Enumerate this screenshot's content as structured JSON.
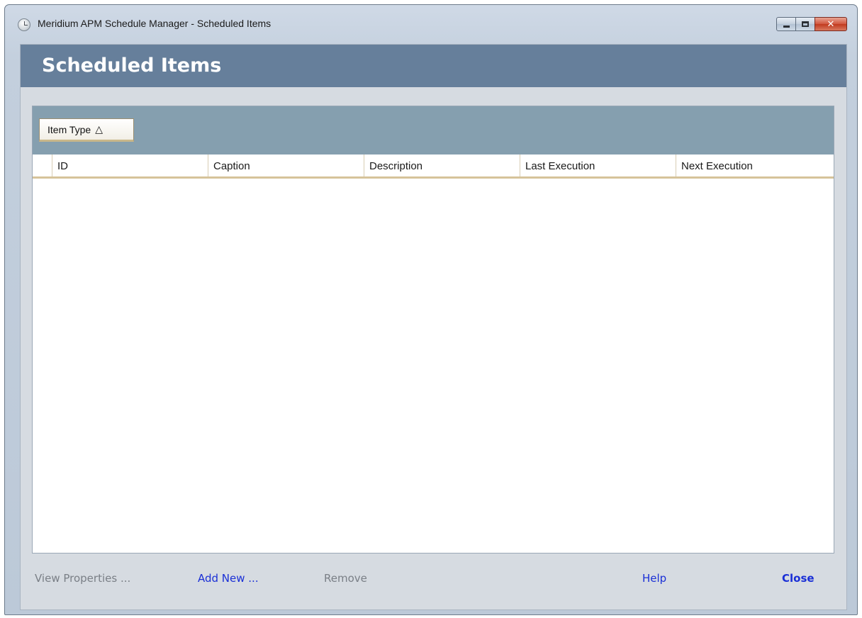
{
  "window": {
    "title": "Meridium APM Schedule Manager - Scheduled Items",
    "controls": {
      "minimize": "minimize",
      "maximize": "maximize",
      "close": "✕"
    }
  },
  "header": {
    "title": "Scheduled Items"
  },
  "grid": {
    "group_by": {
      "label": "Item Type",
      "sort_icon": "△"
    },
    "columns": [
      "ID",
      "Caption",
      "Description",
      "Last Execution",
      "Next Execution"
    ],
    "rows": []
  },
  "footer": {
    "view_properties": "View Properties ...",
    "add_new": "Add New ...",
    "remove": "Remove",
    "help": "Help",
    "close": "Close"
  },
  "icons": {
    "app": "clock-icon",
    "sort": "sort-ascending-icon"
  }
}
